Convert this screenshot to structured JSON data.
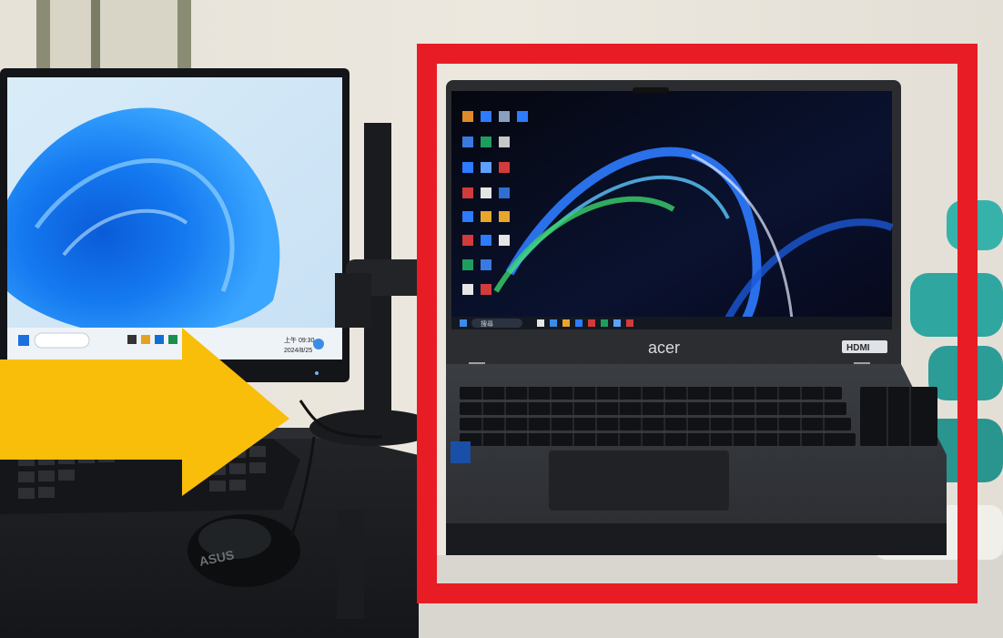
{
  "scene": {
    "laptop_brand": "acer",
    "laptop_port_logo": "HDMI",
    "mouse_brand": "ASUS",
    "monitor_taskbar_time": "上午 09:30",
    "monitor_taskbar_date": "2024/8/25",
    "laptop_taskbar_search": "搜尋"
  },
  "annotations": {
    "arrow_color": "#F9BE0A",
    "highlight_box_color": "#E81C24"
  },
  "icons": [
    "windows-start-icon",
    "arrow-right-icon",
    "highlight-frame-icon"
  ]
}
